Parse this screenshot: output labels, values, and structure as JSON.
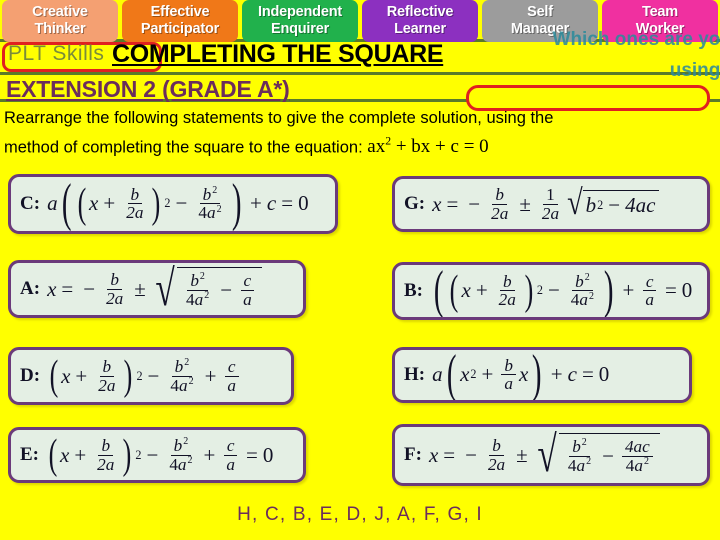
{
  "banner": {
    "name": "plt-skills-banner",
    "tabs": [
      {
        "line1": "Creative",
        "line2": "Thinker",
        "color": "#F4A072"
      },
      {
        "line1": "Effective",
        "line2": "Participator",
        "color": "#F07818"
      },
      {
        "line1": "Independent",
        "line2": "Enquirer",
        "color": "#21B14C"
      },
      {
        "line1": "Reflective",
        "line2": "Learner",
        "color": "#8C30C0"
      },
      {
        "line1": "Self",
        "line2": "Manager",
        "color": "#9C9C9C"
      },
      {
        "line1": "Team",
        "line2": "Worker",
        "color": "#F030A0"
      }
    ]
  },
  "overlay": {
    "line1": "Which ones are you",
    "line2": "using?",
    "color": "#2E8B9B"
  },
  "header": {
    "plt_skills_label": "PLT Skills",
    "title": "COMPLETING THE SQUARE",
    "answer_box_value": "",
    "subtitle": "EXTENSION 2 (GRADE A*)",
    "title_color": "#000000",
    "subtitle_color": "#6B2D5C",
    "box_border_color": "#E02020"
  },
  "instructions": {
    "line1": "Rearrange the following statements to give the complete solution, using the",
    "line2_pre": "method of completing the square to the equation:",
    "equation_text": "ax² + bx + c = 0",
    "equation_parts": {
      "a": "ax",
      "exp": "2",
      "rest": "+ bx + c = 0"
    }
  },
  "cards": [
    {
      "id": "card-c",
      "label": "C:",
      "formula_text": "a((x + b/2a)² − b²/4a²) + c = 0",
      "column": "left",
      "row": 1
    },
    {
      "id": "card-g",
      "label": "G:",
      "formula_text": "x = −b/2a ± (1/2a)√(b² − 4ac)",
      "column": "right",
      "row": 1
    },
    {
      "id": "card-a",
      "label": "A:",
      "formula_text": "x = −b/2a ± √(b²/4a² − c/a)",
      "column": "left",
      "row": 2
    },
    {
      "id": "card-b",
      "label": "B:",
      "formula_text": "((x + b/2a)² − b²/4a²) + c/a = 0",
      "column": "right",
      "row": 2
    },
    {
      "id": "card-d",
      "label": "D:",
      "formula_text": "(x + b/2a)² − b²/4a² + c/a",
      "column": "left",
      "row": 3
    },
    {
      "id": "card-h",
      "label": "H:",
      "formula_text": "a(x² + (b/a)x) + c = 0",
      "column": "right",
      "row": 3
    },
    {
      "id": "card-e",
      "label": "E:",
      "formula_text": "(x + b/2a)² − b²/4a² + c/a = 0",
      "column": "left",
      "row": 4
    },
    {
      "id": "card-f",
      "label": "F:",
      "formula_text": "x = −b/2a ± √(b²/4a² − 4ac/4a²)",
      "column": "right",
      "row": 4
    }
  ],
  "symbols": {
    "x": "x",
    "a": "a",
    "b": "b",
    "c": "c",
    "two_a": "2a",
    "four_a_sq_num": "4",
    "plus": "+",
    "minus": "−",
    "plusminus": "±",
    "equals": "=",
    "zero": "0",
    "one": "1",
    "exp2": "2",
    "four_ac": "4ac",
    "radical": "√",
    "lparen": "(",
    "rparen": ")"
  },
  "answer": {
    "sequence": "H, C, B, E, D, J, A, F, G, I",
    "color": "#6B2D5C"
  }
}
